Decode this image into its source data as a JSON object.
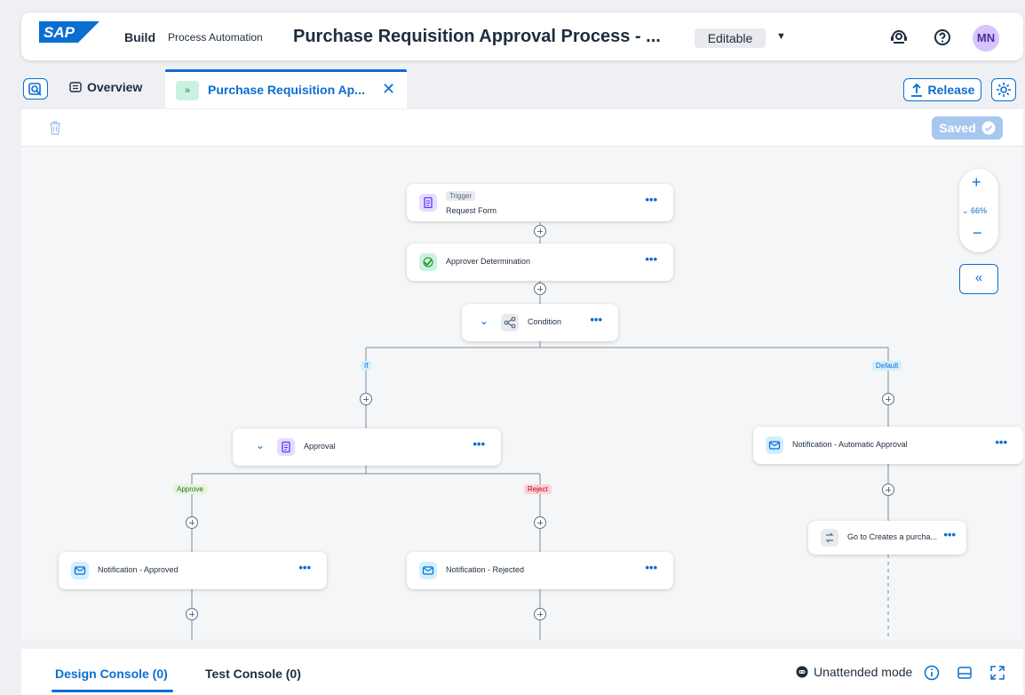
{
  "shell": {
    "logo_text": "SAP",
    "build": "Build",
    "product": "Process Automation",
    "title": "Purchase Requisition Approval Process - ...",
    "mode": "Editable",
    "avatar": "MN"
  },
  "tabs": {
    "overview": "Overview",
    "active": "Purchase Requisition Ap...",
    "release": "Release"
  },
  "toolbar": {
    "saved": "Saved"
  },
  "canvas": {
    "zoom": "66%",
    "nodes": {
      "trigger_tag": "Trigger",
      "trigger_name": "Request Form",
      "approver_det": "Approver Determination",
      "condition": "Condition",
      "approval": "Approval",
      "notif_auto": "Notification - Automatic Approval",
      "goto": "Go to Creates a purcha...",
      "notif_approved": "Notification - Approved",
      "notif_rejected": "Notification - Rejected"
    },
    "branches": {
      "if": "If",
      "default": "Default",
      "approve": "Approve",
      "reject": "Reject"
    },
    "more": "•••"
  },
  "console": {
    "design": "Design Console (0)",
    "test": "Test Console (0)",
    "unattended": "Unattended mode"
  },
  "colors": {
    "accent": "#0a6ed1",
    "avatar_bg": "#d6c4ff"
  }
}
